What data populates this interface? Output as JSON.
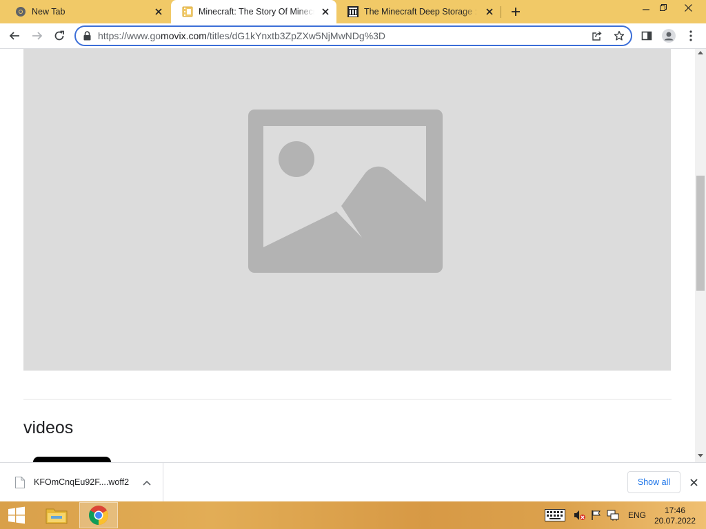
{
  "browser": {
    "tabs": [
      {
        "title": "New Tab",
        "favicon": "chrome-icon",
        "active": false
      },
      {
        "title": "Minecraft: The Story Of Minecraft",
        "favicon": "film-icon",
        "active": true
      },
      {
        "title": "The Minecraft Deep Storage : Free",
        "favicon": "archive-icon",
        "active": false
      }
    ],
    "new_tab_label": "+",
    "address_bar": {
      "url_prefix": "https://www.go",
      "url_rest": "movix.com",
      "url_path": "/titles/dG1kYnxtb3ZpZXw5NjMwNDg%3D"
    }
  },
  "page": {
    "placeholder_image": "image-placeholder-icon",
    "section_heading": "videos"
  },
  "downloads": {
    "file_name": "KFOmCnqEu92F....woff2",
    "show_all_label": "Show all"
  },
  "taskbar": {
    "language": "ENG",
    "time": "17:46",
    "date": "20.07.2022"
  },
  "colors": {
    "tabstrip": "#f1c967",
    "omnibox_border": "#3b6ed8",
    "placeholder_bg": "#dcdcdc",
    "placeholder_icon": "#b3b3b3",
    "link_blue": "#1a73e8"
  }
}
